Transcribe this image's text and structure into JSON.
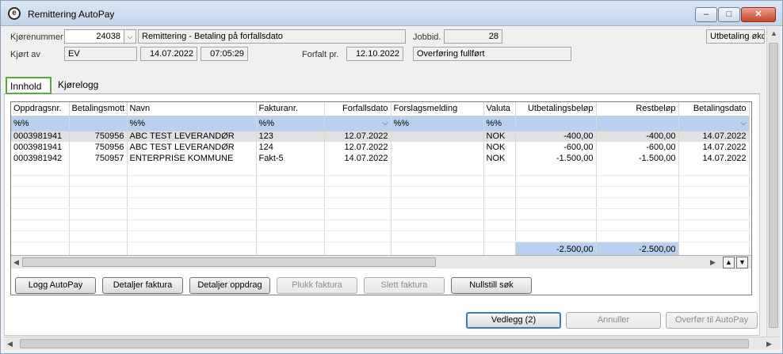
{
  "window": {
    "title": "Remittering AutoPay",
    "minimize": "–",
    "maximize": "□",
    "close": "✕"
  },
  "header": {
    "kjorenummer_label": "Kjørenummer",
    "kjorenummer_value": "24038",
    "beskrivelse": "Remittering - Betaling på forfallsdato",
    "jobbid_label": "Jobbid.",
    "jobbid_value": "28",
    "utbetaling": "Utbetaling økc",
    "kjort_av_label": "Kjørt av",
    "kjort_av_value": "EV",
    "dato": "14.07.2022",
    "tid": "07:05:29",
    "forfalt_label": "Forfalt pr.",
    "forfalt_value": "12.10.2022",
    "status": "Overføring fullført"
  },
  "tabs": [
    {
      "label": "Innhold"
    },
    {
      "label": "Kjørelogg"
    }
  ],
  "grid": {
    "columns": [
      "Oppdragsnr.",
      "Betalingsmott",
      "Navn",
      "Fakturanr.",
      "Forfallsdato",
      "Forslagsmelding",
      "Valuta",
      "Utbetalingsbeløp",
      "Restbeløp",
      "Betalingsdato"
    ],
    "filter": [
      "%%",
      "",
      "%%",
      "%%",
      "",
      "%%",
      "%%",
      "",
      "",
      ""
    ],
    "rows": [
      [
        "0003981941",
        "750956",
        "ABC TEST LEVERANDØR",
        "123",
        "12.07.2022",
        "",
        "NOK",
        "-400,00",
        "-400,00",
        "14.07.2022"
      ],
      [
        "0003981941",
        "750956",
        "ABC TEST LEVERANDØR",
        "124",
        "12.07.2022",
        "",
        "NOK",
        "-600,00",
        "-600,00",
        "14.07.2022"
      ],
      [
        "0003981942",
        "750957",
        "ENTERPRISE KOMMUNE",
        "Fakt-5",
        "14.07.2022",
        "",
        "NOK",
        "-1.500,00",
        "-1.500,00",
        "14.07.2022"
      ]
    ],
    "sum_utbetaling": "-2.500,00",
    "sum_rest": "-2.500,00"
  },
  "buttons": {
    "logg": "Logg AutoPay",
    "detaljer_faktura": "Detaljer faktura",
    "detaljer_oppdrag": "Detaljer oppdrag",
    "plukk": "Plukk faktura",
    "slett": "Slett faktura",
    "nullstill": "Nullstill søk",
    "vedlegg": "Vedlegg (2)",
    "annuller": "Annuller",
    "overfor": "Overfør til AutoPay"
  }
}
